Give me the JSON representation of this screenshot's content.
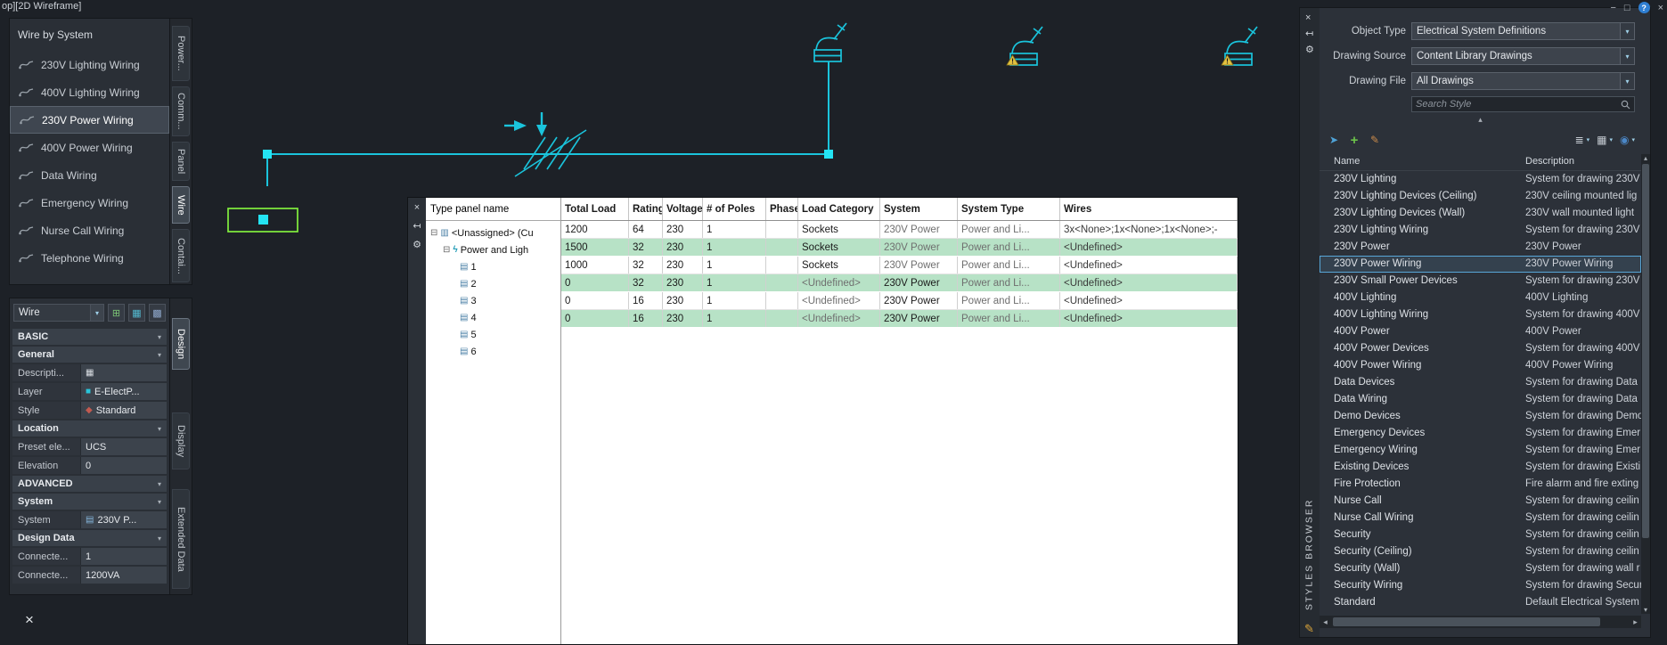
{
  "viewport_label": "op][2D Wireframe]",
  "command_close": "×",
  "window_controls": {
    "minimize": "−",
    "restore": "□",
    "help": "?",
    "close": "×"
  },
  "icons": {
    "close": "×",
    "autohide": "↤",
    "properties_menu": "⚙",
    "dropdown": "▾",
    "chevron_down": "▾",
    "collapse_up": "▴",
    "scroll_left": "◂",
    "scroll_right": "▸",
    "scroll_up": "▴",
    "scroll_down": "▾",
    "expand_minus": "⊟",
    "panel": "▥",
    "bolt": "ϟ",
    "sheet": "▤",
    "table": "▦",
    "layer_swatch": "■",
    "style": "◆",
    "system": "▤",
    "pickadd": "⊞",
    "quick_select": "▦",
    "select_objects": "▩",
    "import_arrow": "➤",
    "add": "+",
    "brush": "✎",
    "list_view": "≣",
    "grid_view": "▦",
    "sphere": "◉",
    "pencil": "✎"
  },
  "tool_palette": {
    "title": "Wire by System",
    "items": [
      {
        "label": "230V Lighting Wiring"
      },
      {
        "label": "400V Lighting Wiring"
      },
      {
        "label": "230V Power Wiring",
        "selected": true
      },
      {
        "label": "400V Power Wiring"
      },
      {
        "label": "Data Wiring"
      },
      {
        "label": "Emergency Wiring"
      },
      {
        "label": "Nurse Call Wiring"
      },
      {
        "label": "Telephone Wiring"
      }
    ],
    "tabs": [
      {
        "label": "Power..."
      },
      {
        "label": "Comm..."
      },
      {
        "label": "Panel"
      },
      {
        "label": "Wire",
        "active": true
      },
      {
        "label": "Contai..."
      }
    ]
  },
  "properties": {
    "selector_value": "Wire",
    "tabs": [
      {
        "label": "Design",
        "active": true
      },
      {
        "label": "Display"
      },
      {
        "label": "Extended Data"
      }
    ],
    "basic_header": "BASIC",
    "general_header": "General",
    "location_header": "Location",
    "advanced_header": "ADVANCED",
    "system_header": "System",
    "design_data_header": "Design Data",
    "description_label": "Descripti...",
    "layer_label": "Layer",
    "layer_value": "E-ElectP...",
    "style_label": "Style",
    "style_value": "Standard",
    "preset_label": "Preset ele...",
    "preset_value": "UCS",
    "elevation_label": "Elevation",
    "elevation_value": "0",
    "system_label": "System",
    "system_value": "230V P...",
    "connected_load_label": "Connecte...",
    "connected_load_value": "1",
    "connected_va_label": "Connecte...",
    "connected_va_value": "1200VA"
  },
  "circuit_manager": {
    "tree_header": "Type panel name",
    "tree_root": "<Unassigned> (Cu",
    "tree_child": "Power and Ligh",
    "tree_leaves": [
      "1",
      "2",
      "3",
      "4",
      "5",
      "6"
    ],
    "columns": [
      "Total Load",
      "Rating",
      "Voltage",
      "# of Poles",
      "Phase",
      "Load Category",
      "System",
      "System Type",
      "Wires"
    ],
    "rows": [
      {
        "cells": [
          "1200",
          "64",
          "230",
          "1",
          "",
          "Sockets",
          "230V Power",
          "Power and Li...",
          "3x<None>;1x<None>;1x<None>;-"
        ],
        "sys_muted": true
      },
      {
        "cells": [
          "1500",
          "32",
          "230",
          "1",
          "",
          "Sockets",
          "230V Power",
          "Power and Li...",
          "<Undefined>"
        ],
        "green": true,
        "sys_muted": true
      },
      {
        "cells": [
          "1000",
          "32",
          "230",
          "1",
          "",
          "Sockets",
          "230V Power",
          "Power and Li...",
          "<Undefined>"
        ],
        "sys_muted": true
      },
      {
        "cells": [
          "0",
          "32",
          "230",
          "1",
          "",
          "<Undefined>",
          "230V Power",
          "Power and Li...",
          "<Undefined>"
        ],
        "green": true,
        "lc_muted": true
      },
      {
        "cells": [
          "0",
          "16",
          "230",
          "1",
          "",
          "<Undefined>",
          "230V Power",
          "Power and Li...",
          "<Undefined>"
        ],
        "lc_muted": true
      },
      {
        "cells": [
          "0",
          "16",
          "230",
          "1",
          "",
          "<Undefined>",
          "230V Power",
          "Power and Li...",
          "<Undefined>"
        ],
        "green": true,
        "lc_muted": true
      }
    ]
  },
  "styles_browser": {
    "panel_label": "STYLES BROWSER",
    "object_type_label": "Object Type",
    "object_type_value": "Electrical System Definitions",
    "drawing_source_label": "Drawing Source",
    "drawing_source_value": "Content Library Drawings",
    "drawing_file_label": "Drawing File",
    "drawing_file_value": "All Drawings",
    "search_placeholder": "Search Style",
    "name_column": "Name",
    "description_column": "Description",
    "rows": [
      {
        "name": "230V Lighting",
        "description": "System for drawing 230V"
      },
      {
        "name": "230V Lighting Devices (Ceiling)",
        "description": "230V ceiling mounted lig"
      },
      {
        "name": "230V Lighting Devices (Wall)",
        "description": "230V wall mounted light"
      },
      {
        "name": "230V Lighting Wiring",
        "description": "System for drawing 230V"
      },
      {
        "name": "230V Power",
        "description": "230V Power"
      },
      {
        "name": "230V Power Wiring",
        "description": "230V Power Wiring",
        "selected": true
      },
      {
        "name": "230V Small Power Devices",
        "description": "System for drawing 230V"
      },
      {
        "name": "400V Lighting",
        "description": "400V Lighting"
      },
      {
        "name": "400V Lighting Wiring",
        "description": "System for drawing 400V"
      },
      {
        "name": "400V Power",
        "description": "400V Power"
      },
      {
        "name": "400V Power Devices",
        "description": "System for drawing 400V"
      },
      {
        "name": "400V Power Wiring",
        "description": "400V Power Wiring"
      },
      {
        "name": "Data Devices",
        "description": "System for drawing Data"
      },
      {
        "name": "Data Wiring",
        "description": "System for drawing Data"
      },
      {
        "name": "Demo Devices",
        "description": "System for drawing Demo"
      },
      {
        "name": "Emergency Devices",
        "description": "System for drawing Emer"
      },
      {
        "name": "Emergency Wiring",
        "description": "System for drawing Emer"
      },
      {
        "name": "Existing Devices",
        "description": "System for drawing Existi"
      },
      {
        "name": "Fire Protection",
        "description": "Fire alarm and fire exting"
      },
      {
        "name": "Nurse Call",
        "description": "System for drawing ceilin"
      },
      {
        "name": "Nurse Call Wiring",
        "description": "System for drawing ceilin"
      },
      {
        "name": "Security",
        "description": "System for drawing ceilin"
      },
      {
        "name": "Security (Ceiling)",
        "description": "System for drawing ceilin"
      },
      {
        "name": "Security (Wall)",
        "description": "System for drawing wall r"
      },
      {
        "name": "Security Wiring",
        "description": "System for drawing Secur"
      },
      {
        "name": "Standard",
        "description": "Default Electrical System"
      }
    ]
  }
}
